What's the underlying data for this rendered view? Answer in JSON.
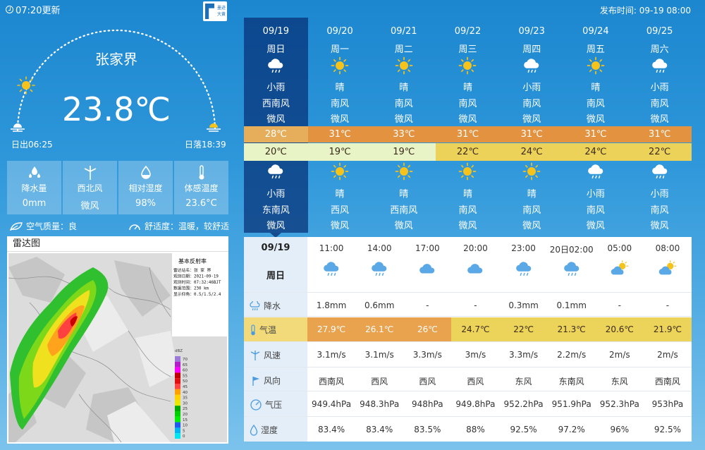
{
  "header": {
    "update_text": "07:20更新",
    "logo_text": "墨迹大黄",
    "publish_text": "发布时间:   09-19 08:00"
  },
  "current": {
    "city": "张家界",
    "temperature": "23.8℃",
    "sunrise": "日出06:25",
    "sunset": "日落18:39"
  },
  "stats": [
    {
      "icon": "water-drops-icon",
      "label": "降水量",
      "value": "0mm"
    },
    {
      "icon": "wind-turbine-icon",
      "label": "西北风",
      "value": "微风"
    },
    {
      "icon": "humidity-drop-icon",
      "label": "相对湿度",
      "value": "98%"
    },
    {
      "icon": "thermometer-icon",
      "label": "体感温度",
      "value": "23.6°C"
    }
  ],
  "air_quality": "空气质量：良",
  "comfort": "舒适度：温暖，较舒适",
  "radar": {
    "title": "雷达图",
    "legend_title": "基本反射率",
    "info_lines": [
      "雷达站名：张 家 界",
      "观测日期：2021-09-19",
      "观测时间：07:32:46BJT",
      "数据范围：230 km",
      "显示仰角：0.5/1.5/2.4"
    ],
    "scale_unit": "dBZ",
    "scale_values": [
      "70",
      "65",
      "60",
      "55",
      "50",
      "45",
      "40",
      "35",
      "30",
      "25",
      "20",
      "15",
      "10",
      "5",
      "0"
    ],
    "scale_colors": [
      "#9c7bd8",
      "#b01fc7",
      "#ff00ff",
      "#c00000",
      "#e01010",
      "#ff4444",
      "#ff9f00",
      "#ffd200",
      "#e8e800",
      "#00a800",
      "#00d000",
      "#00f000",
      "#1e5af0",
      "#00b4f0",
      "#00e6f0"
    ]
  },
  "forecast": [
    {
      "date": "09/19",
      "weekday": "周日",
      "day_icon": "cloud-rain-icon",
      "day_weather": "小雨",
      "day_wind_dir": "西南风",
      "day_wind_lv": "微风",
      "high": "28℃",
      "low": "20℃",
      "night_icon": "cloud-rain-icon",
      "night_weather": "小雨",
      "night_wind_dir": "东南风",
      "night_wind_lv": "微风"
    },
    {
      "date": "09/20",
      "weekday": "周一",
      "day_icon": "sun-icon",
      "day_weather": "晴",
      "day_wind_dir": "南风",
      "day_wind_lv": "微风",
      "high": "31℃",
      "low": "19℃",
      "night_icon": "sun-icon",
      "night_weather": "晴",
      "night_wind_dir": "西风",
      "night_wind_lv": "微风"
    },
    {
      "date": "09/21",
      "weekday": "周二",
      "day_icon": "sun-icon",
      "day_weather": "晴",
      "day_wind_dir": "南风",
      "day_wind_lv": "微风",
      "high": "33℃",
      "low": "19℃",
      "night_icon": "sun-icon",
      "night_weather": "晴",
      "night_wind_dir": "西南风",
      "night_wind_lv": "微风"
    },
    {
      "date": "09/22",
      "weekday": "周三",
      "day_icon": "sun-icon",
      "day_weather": "晴",
      "day_wind_dir": "南风",
      "day_wind_lv": "微风",
      "high": "31℃",
      "low": "22℃",
      "night_icon": "sun-icon",
      "night_weather": "晴",
      "night_wind_dir": "南风",
      "night_wind_lv": "微风"
    },
    {
      "date": "09/23",
      "weekday": "周四",
      "day_icon": "cloud-rain-icon",
      "day_weather": "小雨",
      "day_wind_dir": "南风",
      "day_wind_lv": "微风",
      "high": "31℃",
      "low": "24℃",
      "night_icon": "sun-icon",
      "night_weather": "晴",
      "night_wind_dir": "南风",
      "night_wind_lv": "微风"
    },
    {
      "date": "09/24",
      "weekday": "周五",
      "day_icon": "sun-icon",
      "day_weather": "晴",
      "day_wind_dir": "南风",
      "day_wind_lv": "微风",
      "high": "31℃",
      "low": "24℃",
      "night_icon": "cloud-rain-icon",
      "night_weather": "小雨",
      "night_wind_dir": "南风",
      "night_wind_lv": "微风"
    },
    {
      "date": "09/25",
      "weekday": "周六",
      "day_icon": "cloud-rain-icon",
      "day_weather": "小雨",
      "day_wind_dir": "南风",
      "day_wind_lv": "微风",
      "high": "31℃",
      "low": "22℃",
      "night_icon": "cloud-rain-icon",
      "night_weather": "小雨",
      "night_wind_dir": "南风",
      "night_wind_lv": "微风"
    }
  ],
  "hourly": {
    "date": "09/19",
    "weekday": "周日",
    "times": [
      "11:00",
      "14:00",
      "17:00",
      "20:00",
      "23:00",
      "20日02:00",
      "05:00",
      "08:00"
    ],
    "icons": [
      "cloud-rain-icon",
      "cloud-rain-icon",
      "cloud-icon",
      "cloud-icon",
      "cloud-rain-icon",
      "cloud-rain-icon",
      "partly-cloudy-icon",
      "partly-cloudy-icon"
    ],
    "rows": [
      {
        "label": "降水",
        "icon": "rain-icon",
        "values": [
          "1.8mm",
          "0.6mm",
          "-",
          "-",
          "0.3mm",
          "0.1mm",
          "-",
          "-"
        ]
      },
      {
        "label": "气温",
        "icon": "thermometer-icon",
        "values": [
          "27.9℃",
          "26.1℃",
          "26℃",
          "24.7℃",
          "22℃",
          "21.3℃",
          "20.6℃",
          "21.9℃"
        ]
      },
      {
        "label": "风速",
        "icon": "wind-turbine-icon",
        "values": [
          "3.1m/s",
          "3.1m/s",
          "3.3m/s",
          "3m/s",
          "3.3m/s",
          "2.2m/s",
          "2m/s",
          "2m/s"
        ]
      },
      {
        "label": "风向",
        "icon": "wind-direction-icon",
        "values": [
          "西南风",
          "西风",
          "西风",
          "西风",
          "东风",
          "东南风",
          "东风",
          "西南风"
        ]
      },
      {
        "label": "气压",
        "icon": "pressure-gauge-icon",
        "values": [
          "949.4hPa",
          "948.3hPa",
          "948hPa",
          "949.8hPa",
          "952.2hPa",
          "951.9hPa",
          "952.3hPa",
          "953hPa"
        ]
      },
      {
        "label": "湿度",
        "icon": "humidity-drop-icon",
        "values": [
          "83.4%",
          "83.4%",
          "83.5%",
          "88%",
          "92.5%",
          "97.2%",
          "96%",
          "92.5%"
        ]
      }
    ],
    "temp_colors": [
      "#e9a24e",
      "#e9a24e",
      "#e9a24e",
      "#ecd35a",
      "#ecd35a",
      "#ecd35a",
      "#ecd35a",
      "#ecd35a"
    ]
  }
}
